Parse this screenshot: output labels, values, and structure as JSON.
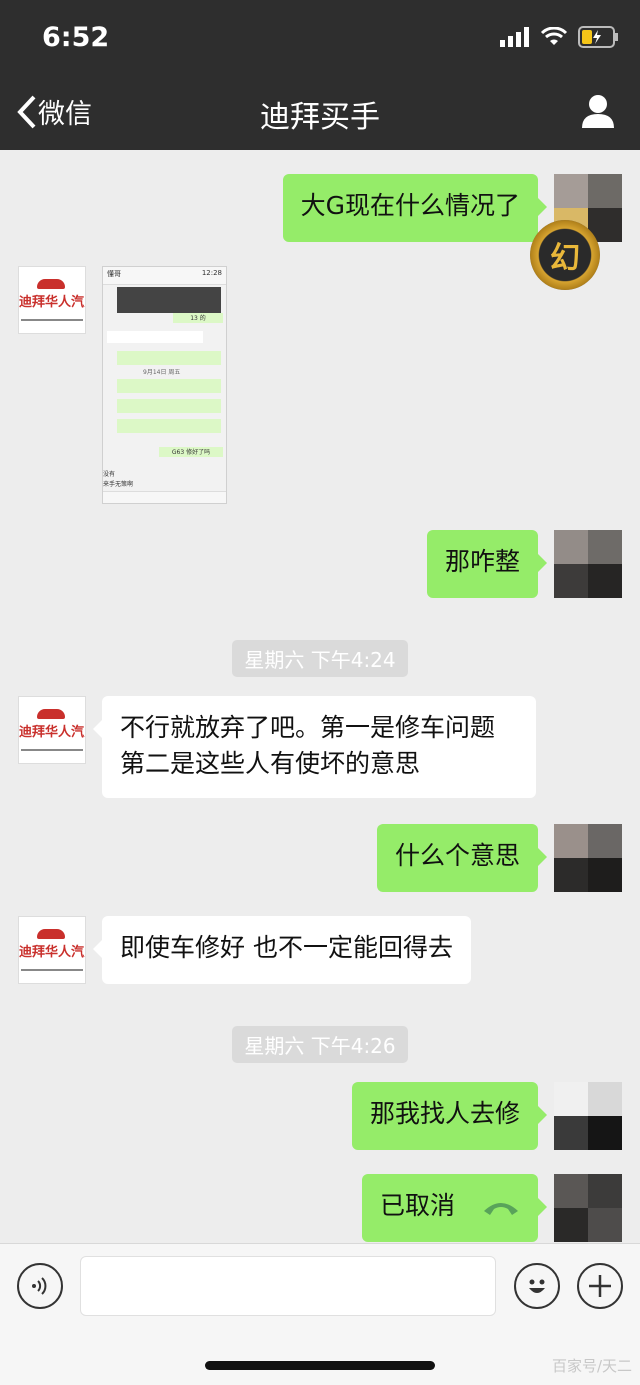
{
  "status_bar": {
    "time": "6:52"
  },
  "nav": {
    "back_label": "微信",
    "title": "迪拜买手"
  },
  "dealer": {
    "logo_text": "迪拜华人汽贸"
  },
  "messages": {
    "m1": "大G现在什么情况了",
    "m2": "那咋整",
    "ts1": "星期六 下午4:24",
    "m3": "不行就放弃了吧。第一是修车问题 第二是这些人有使坏的意思",
    "m4": "什么个意思",
    "m5": "即使车修好 也不一定能回得去",
    "ts2": "星期六 下午4:26",
    "m6": "那我找人去修",
    "m7": "已取消"
  },
  "screenshot_image": {
    "contact": "懂哥",
    "time": "12:28",
    "label_13": "13 的",
    "date_label": "9月14日 周五",
    "g63": "G63 修好了吗",
    "no": "没有",
    "text2": "来手无策啊"
  },
  "avatar_badge": "幻",
  "watermark": "百家号/天二",
  "colors": {
    "out_bubble": "#95ec69",
    "in_bubble": "#ffffff",
    "header": "#2e2e2e",
    "chat_bg": "#ededed"
  }
}
